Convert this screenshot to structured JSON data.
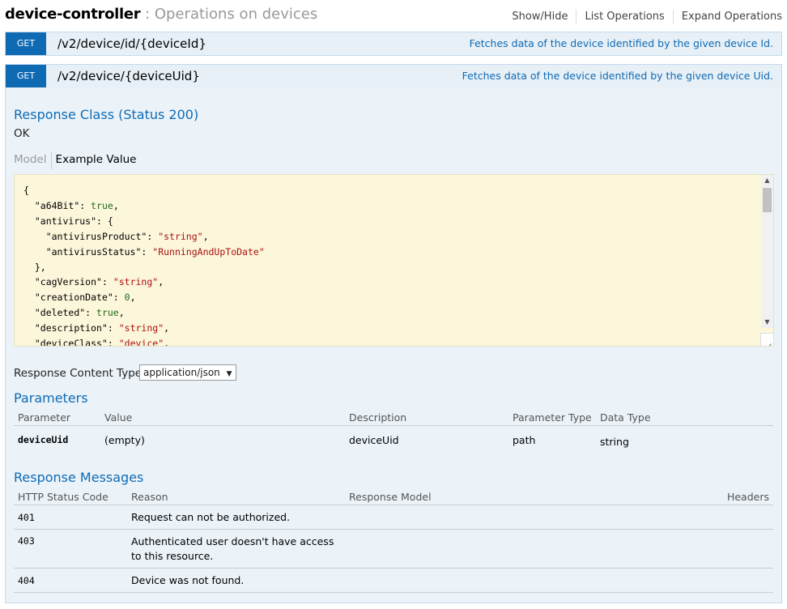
{
  "header": {
    "name": "device-controller",
    "description": " : Operations on devices",
    "nav": [
      "Show/Hide",
      "List Operations",
      "Expand Operations"
    ]
  },
  "operations": [
    {
      "verb": "GET",
      "path": "/v2/device/id/{deviceId}",
      "summary": "Fetches data of the device identified by the given device Id."
    },
    {
      "verb": "GET",
      "path": "/v2/device/{deviceUid}",
      "summary": "Fetches data of the device identified by the given device Uid."
    }
  ],
  "response_class": {
    "title": "Response Class (Status 200)",
    "status_text": "OK",
    "tabs": [
      "Model",
      "Example Value"
    ]
  },
  "example_json": [
    {
      "indent": 0,
      "text": "{"
    },
    {
      "indent": 1,
      "key": "\"a64Bit\"",
      "value": "true",
      "type": "bool",
      "trail": ","
    },
    {
      "indent": 1,
      "key": "\"antivirus\"",
      "value": "{",
      "type": "punct",
      "trail": ""
    },
    {
      "indent": 2,
      "key": "\"antivirusProduct\"",
      "value": "\"string\"",
      "type": "string",
      "trail": ","
    },
    {
      "indent": 2,
      "key": "\"antivirusStatus\"",
      "value": "\"RunningAndUpToDate\"",
      "type": "string",
      "trail": ""
    },
    {
      "indent": 1,
      "text": "},"
    },
    {
      "indent": 1,
      "key": "\"cagVersion\"",
      "value": "\"string\"",
      "type": "string",
      "trail": ","
    },
    {
      "indent": 1,
      "key": "\"creationDate\"",
      "value": "0",
      "type": "number",
      "trail": ","
    },
    {
      "indent": 1,
      "key": "\"deleted\"",
      "value": "true",
      "type": "bool",
      "trail": ","
    },
    {
      "indent": 1,
      "key": "\"description\"",
      "value": "\"string\"",
      "type": "string",
      "trail": ","
    },
    {
      "indent": 1,
      "key": "\"deviceClass\"",
      "value": "\"device\"",
      "type": "string",
      "trail": ","
    }
  ],
  "content_type": {
    "label": "Response Content Type",
    "selected": "application/json"
  },
  "parameters": {
    "title": "Parameters",
    "headers": [
      "Parameter",
      "Value",
      "Description",
      "Parameter Type",
      "Data Type"
    ],
    "rows": [
      {
        "name": "deviceUid",
        "value": "(empty)",
        "description": "deviceUid",
        "param_type": "path",
        "data_type": "string"
      }
    ]
  },
  "response_messages": {
    "title": "Response Messages",
    "headers": [
      "HTTP Status Code",
      "Reason",
      "Response Model",
      "Headers"
    ],
    "rows": [
      {
        "code": "401",
        "reason": "Request can not be authorized.",
        "model": "",
        "headers": ""
      },
      {
        "code": "403",
        "reason": "Authenticated user doesn't have access to this resource.",
        "model": "",
        "headers": ""
      },
      {
        "code": "404",
        "reason": "Device was not found.",
        "model": "",
        "headers": ""
      }
    ]
  },
  "colors": {
    "verb_get": "#0f6ab4",
    "op_background": "#e7f0f7",
    "code_background": "#fcf6db",
    "string_value": "#aa1111",
    "literal_value": "#1c6b1c"
  }
}
